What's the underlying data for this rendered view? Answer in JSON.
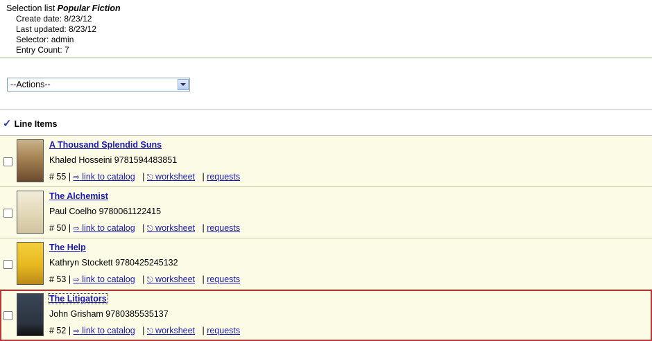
{
  "summary": {
    "prefix": "Selection list",
    "list_name": "Popular Fiction",
    "create_date": "Create date: 8/23/12",
    "last_updated": "Last updated: 8/23/12",
    "selector": "Selector: admin",
    "entry_count": "Entry Count: 7"
  },
  "actions": {
    "selected": "--Actions--"
  },
  "line_items": {
    "heading": "Line Items",
    "link_catalog": "link to catalog",
    "worksheet": "worksheet",
    "requests": "requests",
    "items": [
      {
        "title": "A Thousand Splendid Suns",
        "author_isbn": "Khaled Hosseini 9781594483851",
        "number": "# 55",
        "cover_color": "#6a4a2e"
      },
      {
        "title": "The Alchemist",
        "author_isbn": "Paul Coelho 9780061122415",
        "number": "# 50",
        "cover_color": "#e8e2cc"
      },
      {
        "title": "The Help",
        "author_isbn": "Kathryn Stockett 9780425245132",
        "number": "# 53",
        "cover_color": "#e7b81f"
      },
      {
        "title": "The Litigators",
        "author_isbn": "John Grisham 9780385535137",
        "number": "# 52",
        "cover_color": "#2b3440"
      }
    ]
  }
}
